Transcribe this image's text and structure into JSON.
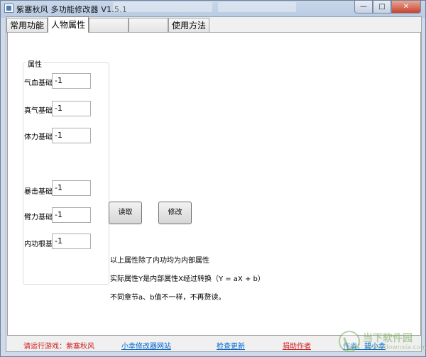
{
  "window": {
    "title": "紫塞秋风 多功能修改器 V1.5.1",
    "minimize_glyph": "—",
    "maximize_glyph": "□",
    "close_glyph": "✕"
  },
  "tabs": [
    {
      "label": "常用功能"
    },
    {
      "label": "人物属性"
    },
    {
      "label": ""
    },
    {
      "label": ""
    },
    {
      "label": "使用方法"
    }
  ],
  "group": {
    "title": "属性"
  },
  "fields": [
    {
      "label": "气血基础",
      "value": "-1"
    },
    {
      "label": "真气基础",
      "value": "-1"
    },
    {
      "label": "体力基础",
      "value": "-1"
    },
    {
      "label": "暴击基础",
      "value": "-1"
    },
    {
      "label": "臂力基础",
      "value": "-1"
    },
    {
      "label": "内功根基",
      "value": "-1"
    }
  ],
  "buttons": {
    "read": "读取",
    "modify": "修改"
  },
  "notes": [
    "以上属性除了内功均为内部属性",
    "实际属性Y是内部属性X经过转换（Y = aX + b）",
    "不同章节a、b值不一样，不再赘读。"
  ],
  "footer": {
    "status": "请运行游戏：紫塞秋风",
    "site_link": "小幸修改器网站",
    "update_link": "检查更新",
    "donate_link": "捐助作者",
    "author_link": "作者：碧小幸"
  },
  "watermark": {
    "name": "当下软件园",
    "url": "www.downxia.com"
  },
  "colors": {
    "link": "#0066cc",
    "status": "#d21f1f",
    "watermark": "#7fae62"
  }
}
